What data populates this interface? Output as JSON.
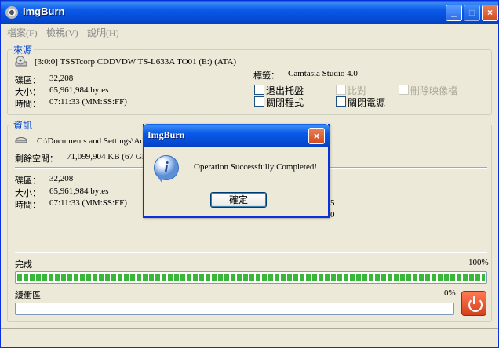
{
  "window": {
    "title": "ImgBurn"
  },
  "menu": [
    "檔案(F)",
    "檢視(V)",
    "說明(H)"
  ],
  "source": {
    "group_label": "來源",
    "drive": "[3:0:0] TSSTcorp CDDVDW TS-L633A TO01 (E:) (ATA)",
    "rows": [
      {
        "label": "碟區：",
        "value": "32,208"
      },
      {
        "label": "大小：",
        "value": "65,961,984 bytes"
      },
      {
        "label": "時間：",
        "value": "07:11:33 (MM:SS:FF)"
      }
    ],
    "label_title": "標籤：",
    "label_value": "Camtasia Studio 4.0",
    "options": [
      {
        "label": "退出托盤",
        "enabled": true
      },
      {
        "label": "比對",
        "enabled": false
      },
      {
        "label": "刪除映像檔",
        "enabled": false
      },
      {
        "label": "關閉程式",
        "enabled": true
      },
      {
        "label": "關閉電源",
        "enabled": true
      }
    ]
  },
  "info": {
    "group_label": "資訊",
    "path": "C:\\Documents and Settings\\Adm",
    "free_label": "剩餘空間：",
    "free_value": "71,099,904 KB  (67 GB",
    "rows": [
      {
        "label": "碟區：",
        "value": "32,208"
      },
      {
        "label": "大小：",
        "value": "65,961,984 bytes"
      },
      {
        "label": "時間：",
        "value": "07:11:33 (MM:SS:FF)"
      }
    ],
    "partial_values": [
      "5",
      "0"
    ]
  },
  "progress": {
    "complete_label": "完成",
    "complete_pct": "100%",
    "complete_value": 100,
    "buffer_label": "緩衝區",
    "buffer_pct": "0%",
    "buffer_value": 0
  },
  "dialog": {
    "title": "ImgBurn",
    "message": "Operation Successfully Completed!",
    "ok_label": "確定",
    "icon": "info-icon"
  },
  "colors": {
    "titlebar": "#0a5ae8",
    "group_label": "#0046d5",
    "progress": "#3ab73a",
    "window_bg": "#ece9d8"
  }
}
